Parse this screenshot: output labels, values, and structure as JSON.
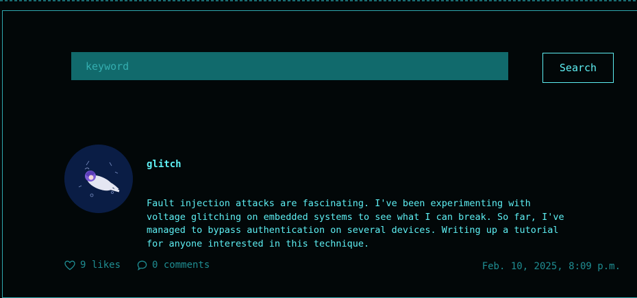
{
  "search": {
    "placeholder": "keyword",
    "value": "",
    "button_label": "Search"
  },
  "post": {
    "author": "glitch",
    "body": "Fault injection attacks are fascinating. I've been experimenting with\nvoltage glitching on embedded systems to see what I can break. So far, I've\nmanaged to bypass authentication on several devices. Writing up a tutorial\nfor anyone interested in this technique.",
    "likes_text": "9 likes",
    "comments_text": "0 comments",
    "timestamp": "Feb. 10, 2025, 8:09 p.m."
  },
  "icons": {
    "like": "heart-icon",
    "comment": "speech-bubble-icon",
    "avatar": "avatar-illustration"
  },
  "colors": {
    "background": "#020708",
    "accent": "#5ef0f4",
    "input_fill": "#116a6c",
    "muted": "#1f8d92",
    "avatar_bg": "#0a1d45"
  }
}
